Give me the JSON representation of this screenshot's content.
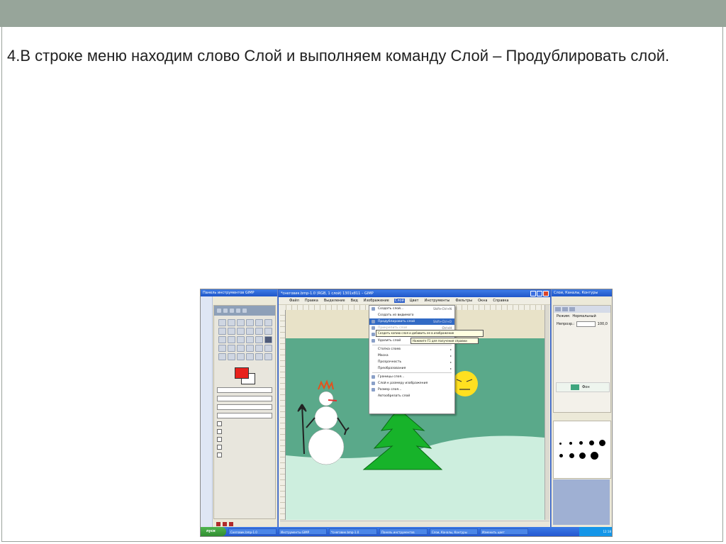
{
  "slide": {
    "instruction": "4.В строке меню находим слово Слой и выполняем  команду Слой – Продублировать слой."
  },
  "screenshot": {
    "toolbox": {
      "title": "Панель инструментов GIMP"
    },
    "gimp_window": {
      "title": "*снеговик.bmp-1.0 (RGB, 1 слой) 1301x811 – GIMP",
      "menubar": [
        "Файл",
        "Правка",
        "Выделение",
        "Вид",
        "Изображение",
        "Слой",
        "Цвет",
        "Инструменты",
        "Фильтры",
        "Окна",
        "Справка"
      ],
      "active_menu": "Слой"
    },
    "layer_menu": {
      "items": [
        {
          "label": "Создать слой...",
          "shortcut": "Shift+Ctrl+N"
        },
        {
          "label": "Создать из видимого",
          "shortcut": ""
        },
        {
          "label": "Продублировать слой",
          "shortcut": "Shift+Ctrl+D",
          "selected": true
        },
        {
          "label": "Прикрепить слой",
          "shortcut": "Ctrl+H"
        },
        {
          "label": "Объединить с предыдущим",
          "shortcut": ""
        },
        {
          "label": "Удалить слой",
          "shortcut": ""
        },
        {
          "label": "Стопка слоев",
          "shortcut": "▸"
        },
        {
          "label": "Маска",
          "shortcut": "▸"
        },
        {
          "label": "Прозрачность",
          "shortcut": "▸"
        },
        {
          "label": "Преобразования",
          "shortcut": "▸"
        },
        {
          "label": "Границы слоя...",
          "shortcut": ""
        },
        {
          "label": "Слой к размеру изображения",
          "shortcut": ""
        },
        {
          "label": "Размер слоя...",
          "shortcut": ""
        },
        {
          "label": "Автообрезать слой",
          "shortcut": ""
        }
      ],
      "tooltip": "Создать копию слоя и добавить ее в изображение",
      "tooltip_hint": "Нажмите F1 для получения справки"
    },
    "layers_dialog": {
      "title": "Слои, Каналы, Контуры",
      "mode_label": "Режим:",
      "mode_value": "Нормальный",
      "opacity_label": "Непрозр.:",
      "opacity_value": "100,0",
      "layer_name": "Фон"
    },
    "taskbar": {
      "start": "пуск",
      "tasks": [
        "Снеговик.bmp-1.0",
        "Инструменты GIMP",
        "*снеговик.bmp-1.0",
        "Панель инструментов",
        "Слои, Каналы, Контуры",
        "Изменить цвет"
      ],
      "clock": "12:18"
    }
  }
}
